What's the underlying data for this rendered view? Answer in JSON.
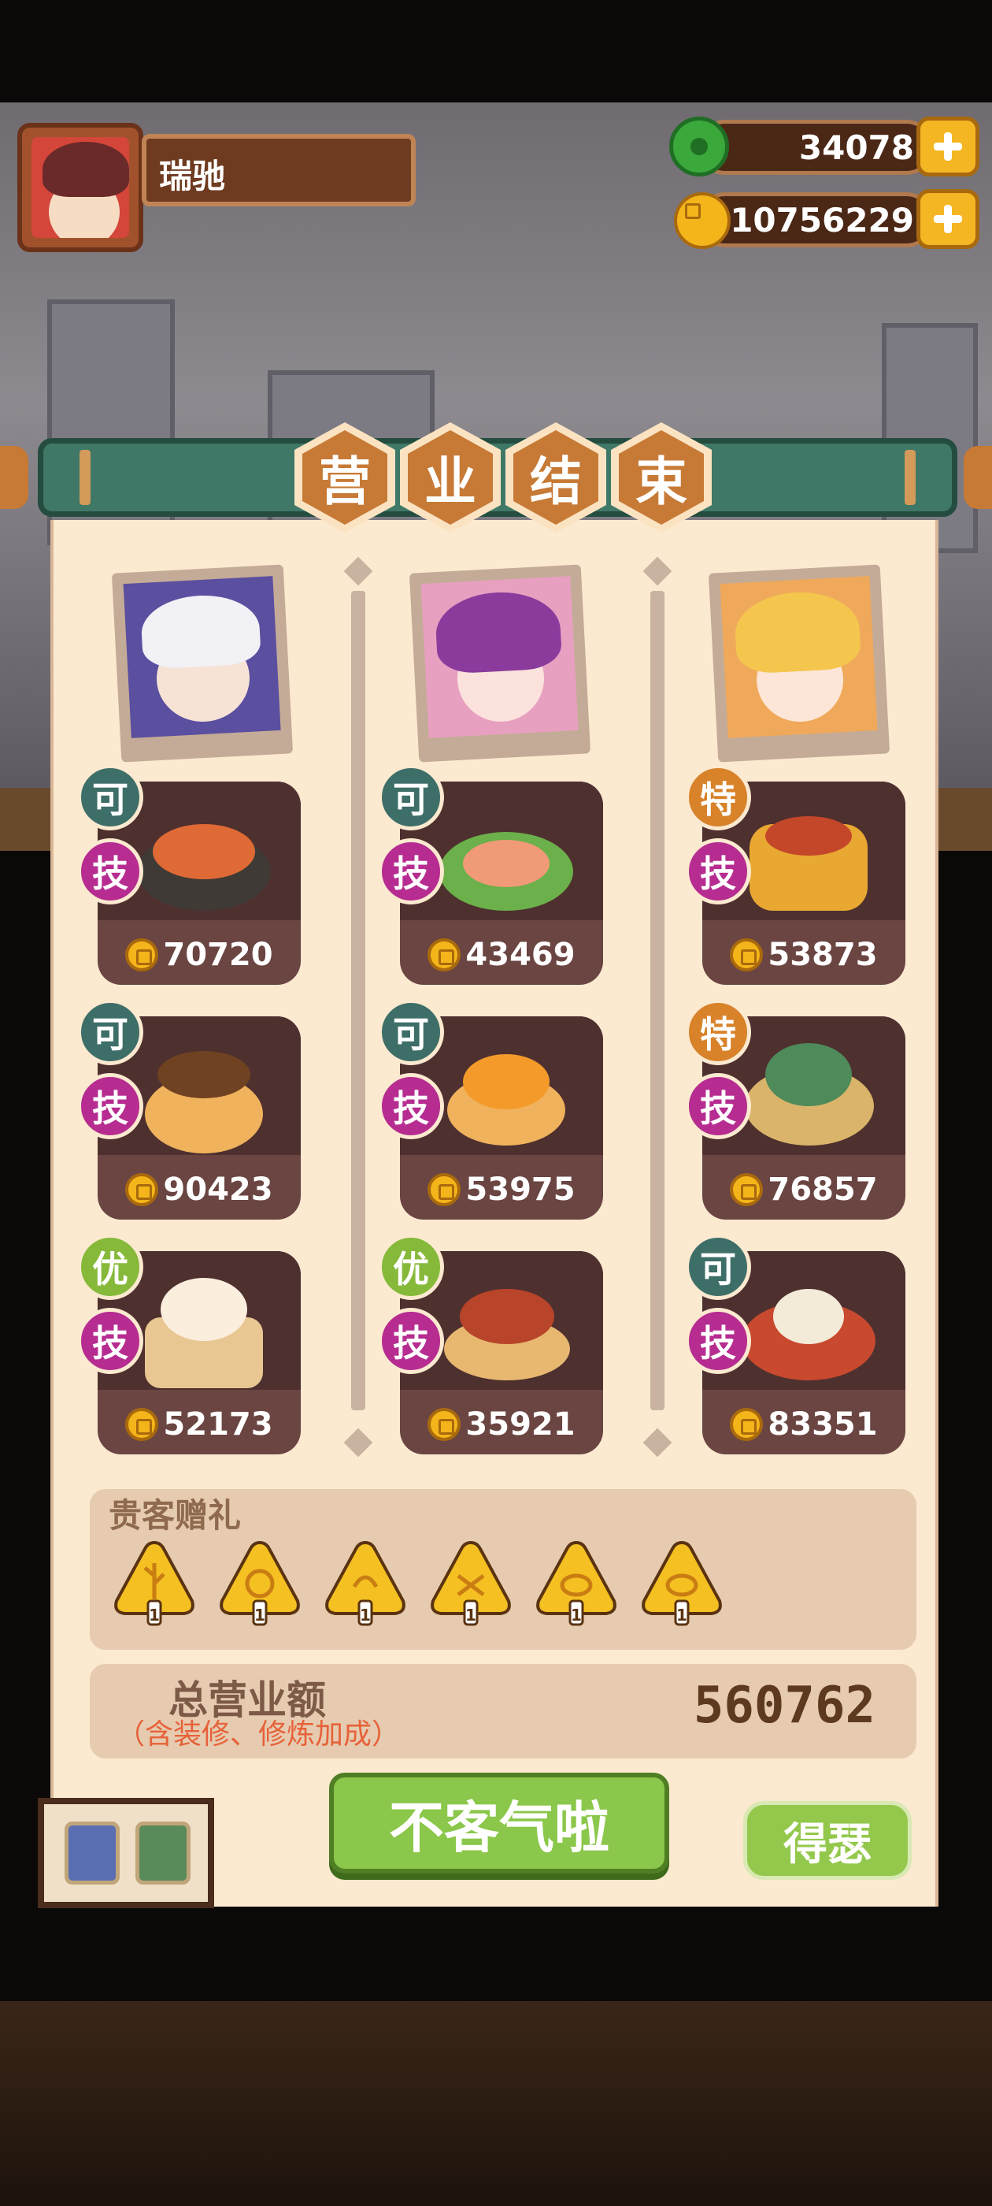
{
  "player": {
    "name": "瑞驰"
  },
  "currencies": [
    {
      "icon": "jade-icon",
      "value": "34078"
    },
    {
      "icon": "gold-coin-icon",
      "value": "10756229"
    }
  ],
  "banner": {
    "chars": [
      "营",
      "业",
      "结",
      "束"
    ]
  },
  "columns": [
    {
      "dishes": [
        {
          "grade": "可",
          "badge": "技",
          "price": "70720"
        },
        {
          "grade": "可",
          "badge": "技",
          "price": "90423"
        },
        {
          "grade": "优",
          "badge": "技",
          "price": "52173"
        }
      ]
    },
    {
      "dishes": [
        {
          "grade": "可",
          "badge": "技",
          "price": "43469"
        },
        {
          "grade": "可",
          "badge": "技",
          "price": "53975"
        },
        {
          "grade": "优",
          "badge": "技",
          "price": "35921"
        }
      ]
    },
    {
      "dishes": [
        {
          "grade": "特",
          "badge": "技",
          "price": "53873"
        },
        {
          "grade": "特",
          "badge": "技",
          "price": "76857"
        },
        {
          "grade": "可",
          "badge": "技",
          "price": "83351"
        }
      ]
    }
  ],
  "gifts": {
    "title": "贵客赠礼",
    "items": [
      {
        "icon": "tree-gift-icon",
        "count": "1"
      },
      {
        "icon": "spiral-gift-icon",
        "count": "1"
      },
      {
        "icon": "swirl-gift-icon",
        "count": "1"
      },
      {
        "icon": "knot-gift-icon",
        "count": "1"
      },
      {
        "icon": "elephant-gift-icon",
        "count": "1"
      },
      {
        "icon": "elephant-gift-icon",
        "count": "1"
      }
    ]
  },
  "total": {
    "label": "总营业额",
    "sublabel": "（含装修、修炼加成）",
    "value": "560762"
  },
  "buttons": {
    "confirm": "不客气啦",
    "share": "得瑟"
  },
  "colors": {
    "panel": "#fbe9d0",
    "accent": "#c77a36",
    "confirm": "#8ac74a"
  }
}
